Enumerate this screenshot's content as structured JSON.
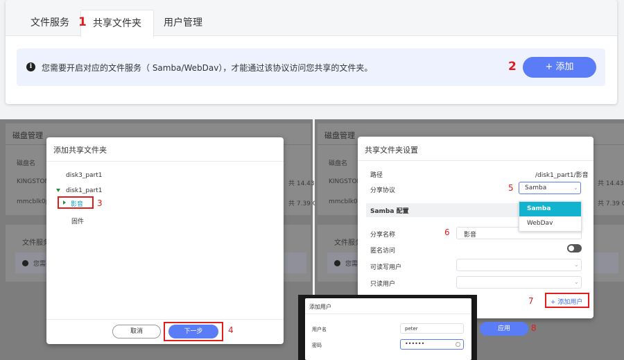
{
  "top": {
    "tabs": [
      "文件服务",
      "共享文件夹",
      "用户管理"
    ],
    "notice_icon": "i",
    "notice_text": "您需要开启对应的文件服务（ Samba/WebDav），才能通过该协议访问您共享的文件夹。",
    "add_button": "+ 添加"
  },
  "steps": [
    "1",
    "2",
    "3",
    "4",
    "5",
    "6",
    "7",
    "8"
  ],
  "bg_left": {
    "title": "磁盘管理",
    "col": "磁盘名",
    "row1": "KINGSTON",
    "row2": "mmcblk0p",
    "section": "文件服务",
    "notice": "您需要"
  },
  "bg_right": {
    "title": "磁盘管理",
    "col": "磁盘名",
    "row1": "KINGSTON",
    "row1_tail": "共 14.43",
    "row2": "mmcblk0p1",
    "row2_tail": "共 7.39 G",
    "section": "文件服务",
    "notice": "您需要"
  },
  "bg_left_tails": {
    "row1_tail": "共 14.43",
    "row2_tail": "共 7.39 G"
  },
  "add_dialog": {
    "title": "添加共享文件夹",
    "tree": [
      "disk3_part1",
      "disk1_part1",
      "影音",
      "固件"
    ],
    "cancel": "取消",
    "next": "下一步"
  },
  "settings": {
    "title": "共享文件夹设置",
    "path_label": "路径",
    "path_value": "/disk1_part1/影音",
    "protocol_label": "分享协议",
    "protocol_value": "Samba",
    "protocol_options": [
      "Samba",
      "WebDav"
    ],
    "samba_section": "Samba 配置",
    "share_name_label": "分享名称",
    "share_name_value": "影音",
    "anon_label": "匿名访问",
    "rw_users_label": "可读写用户",
    "ro_users_label": "只读用户",
    "add_user": "+ 添加用户",
    "apply": "应用"
  },
  "add_user": {
    "title": "添加用户",
    "username_label": "用户名",
    "username_value": "peter",
    "password_label": "密码",
    "password_value": "••••••"
  },
  "colors": {
    "accent": "#5a7cf6",
    "marker": "#e31b1b",
    "selected_option": "#11b3cf"
  }
}
